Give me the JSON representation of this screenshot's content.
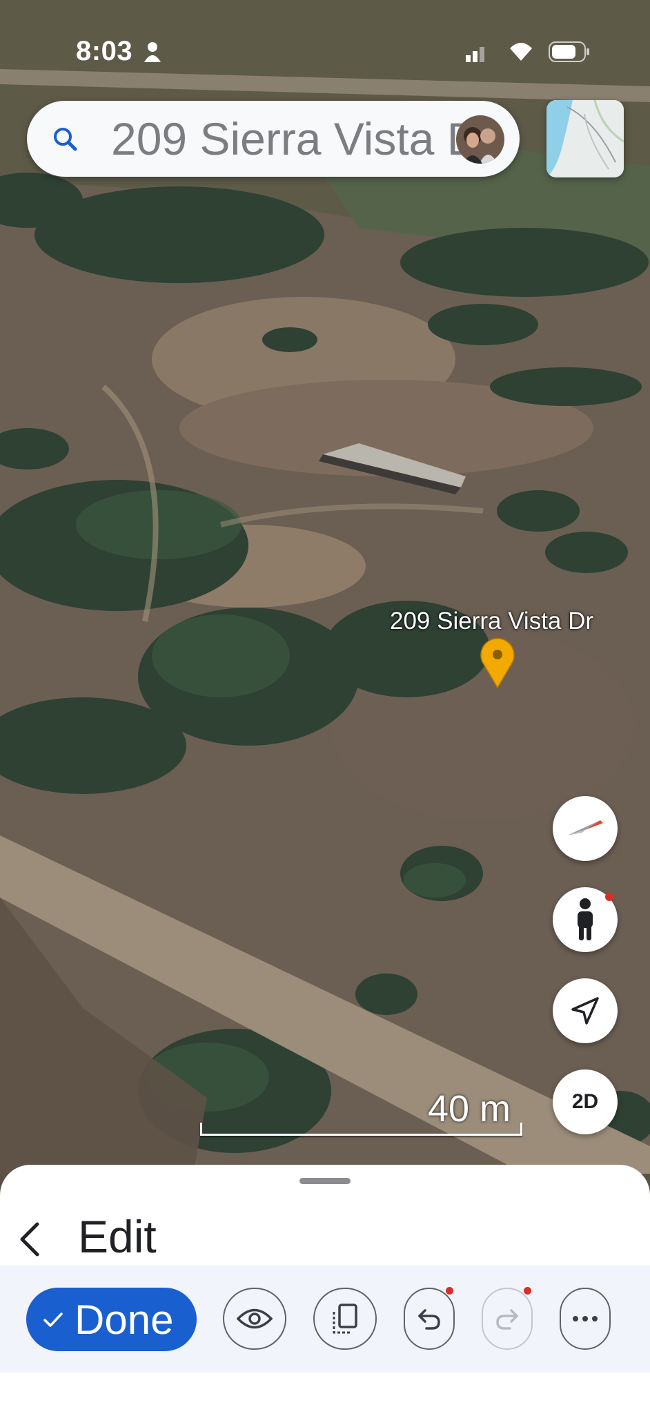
{
  "status_bar": {
    "time": "8:03",
    "icons": [
      "person-icon",
      "signal-icon",
      "wifi-icon",
      "battery-icon"
    ]
  },
  "search": {
    "value": "209 Sierra Vista Dr",
    "icon": "search-icon"
  },
  "map": {
    "type": "satellite-3d",
    "place_label": "209 Sierra Vista Dr",
    "pin_color": "#f2a900",
    "scale_label": "40 m"
  },
  "map_controls": {
    "compass_icon": "compass-icon",
    "street_view_icon": "pegman-icon",
    "location_icon": "navigation-arrow-icon",
    "view_toggle_label": "2D"
  },
  "sheet": {
    "title": "Edit",
    "back_icon": "back-chevron-icon",
    "done_label": "Done",
    "tools": [
      "eye-icon",
      "copy-icon",
      "undo-icon",
      "redo-icon",
      "more-icon"
    ]
  },
  "colors": {
    "accent": "#1a5fd0",
    "badge": "#d93025",
    "toolbar_bg": "#f1f4fb"
  }
}
